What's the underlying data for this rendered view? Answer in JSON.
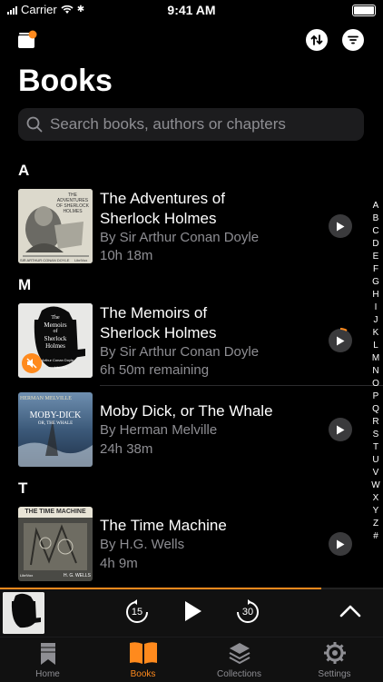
{
  "status_bar": {
    "carrier": "Carrier",
    "time": "9:41 AM"
  },
  "page": {
    "title": "Books"
  },
  "search": {
    "placeholder": "Search books, authors or chapters"
  },
  "sections": [
    {
      "letter": "A"
    },
    {
      "letter": "M"
    },
    {
      "letter": "T"
    }
  ],
  "books": [
    {
      "title_line1": "The Adventures of",
      "title_line2": "Sherlock Holmes",
      "author": "By Sir Arthur Conan Doyle",
      "duration": "10h 18m"
    },
    {
      "title_line1": "The Memoirs of",
      "title_line2": "Sherlock Holmes",
      "author": "By Sir Arthur Conan Doyle",
      "duration": "6h 50m remaining",
      "progress": 0.1
    },
    {
      "title_line1": "Moby Dick, or The Whale",
      "author": "By Herman Melville",
      "duration": "24h 38m"
    },
    {
      "title_line1": "The Time Machine",
      "author": "By H.G. Wells",
      "duration": "4h 9m"
    }
  ],
  "covers": {
    "adventures": {
      "text": "THE ADVENTURES OF SHERLOCK HOLMES",
      "author": "SIR ARTHUR CONAN DOYLE",
      "badge": "LibriVox"
    },
    "memoirs": {
      "line1": "The",
      "line2": "Memoirs",
      "line3": "of",
      "line4": "Sherlock",
      "line5": "Holmes",
      "author": "Arthur Conan Doyle",
      "badge": "LibriVox"
    },
    "moby": {
      "top": "HERMAN MELVILLE",
      "title": "MOBY-DICK",
      "sub": "OR, THE WHALE"
    },
    "time": {
      "title": "THE TIME MACHINE",
      "author": "H. G. WELLS",
      "badge": "LibriVox"
    }
  },
  "az_index": [
    "A",
    "B",
    "C",
    "D",
    "E",
    "F",
    "G",
    "H",
    "I",
    "J",
    "K",
    "L",
    "M",
    "N",
    "O",
    "P",
    "Q",
    "R",
    "S",
    "T",
    "U",
    "V",
    "W",
    "X",
    "Y",
    "Z",
    "#"
  ],
  "player": {
    "rewind": "15",
    "forward": "30",
    "progress": 0.84
  },
  "tabs": [
    {
      "label": "Home"
    },
    {
      "label": "Books"
    },
    {
      "label": "Collections"
    },
    {
      "label": "Settings"
    }
  ],
  "colors": {
    "accent": "#ff8a1d",
    "secondary_text": "#8e8e93",
    "background": "#000000"
  }
}
